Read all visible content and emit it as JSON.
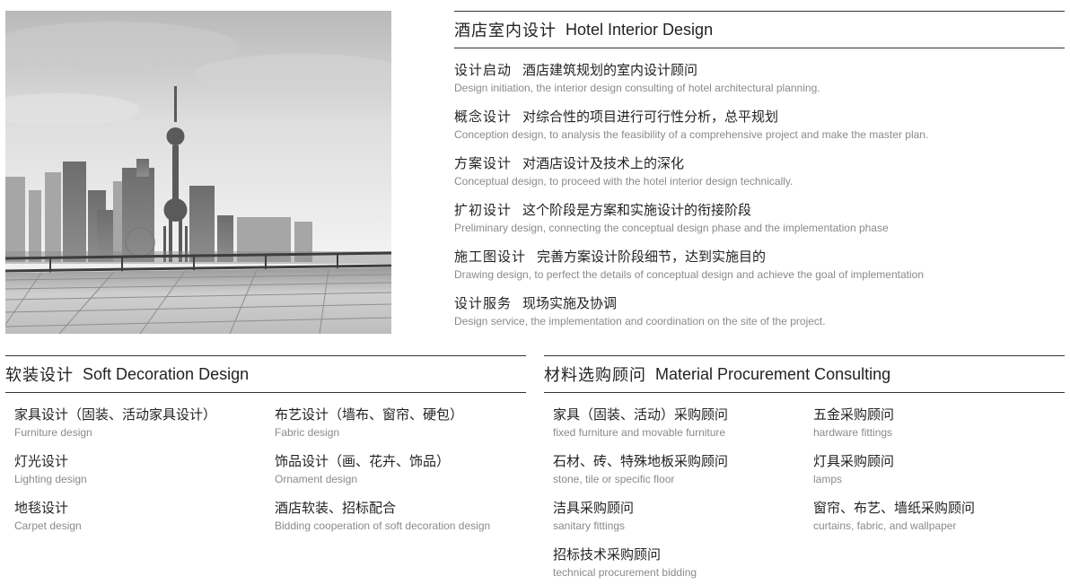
{
  "hotel": {
    "heading_zh": "酒店室内设计",
    "heading_en": "Hotel Interior Design",
    "items": [
      {
        "title": "设计启动",
        "desc": "酒店建筑规划的室内设计顾问",
        "en": "Design initiation, the interior design consulting of hotel architectural planning."
      },
      {
        "title": "概念设计",
        "desc": "对综合性的项目进行可行性分析，总平规划",
        "en": "Conception design, to analysis the feasibility of a comprehensive project and make the master plan."
      },
      {
        "title": "方案设计",
        "desc": "对酒店设计及技术上的深化",
        "en": "Conceptual design, to proceed with the hotel interior design technically."
      },
      {
        "title": "扩初设计",
        "desc": "这个阶段是方案和实施设计的衔接阶段",
        "en": "Preliminary design, connecting the conceptual design phase and the implementation phase"
      },
      {
        "title": "施工图设计",
        "desc": "完善方案设计阶段细节，达到实施目的",
        "en": "Drawing design, to perfect the details of conceptual design and achieve the goal of implementation"
      },
      {
        "title": "设计服务",
        "desc": "现场实施及协调",
        "en": "Design service, the implementation and coordination on the site of the project."
      }
    ]
  },
  "soft": {
    "heading_zh": "软装设计",
    "heading_en": "Soft Decoration Design",
    "items": [
      {
        "zh": "家具设计（固装、活动家具设计）",
        "en": "Furniture design"
      },
      {
        "zh": "布艺设计（墙布、窗帘、硬包）",
        "en": "Fabric design"
      },
      {
        "zh": "灯光设计",
        "en": "Lighting design"
      },
      {
        "zh": "饰品设计（画、花卉、饰品）",
        "en": "Ornament design"
      },
      {
        "zh": "地毯设计",
        "en": "Carpet design"
      },
      {
        "zh": "酒店软装、招标配合",
        "en": "Bidding cooperation of soft decoration design"
      }
    ]
  },
  "material": {
    "heading_zh": "材料选购顾问",
    "heading_en": "Material Procurement Consulting",
    "items": [
      {
        "zh": "家具（固装、活动）采购顾问",
        "en": "fixed furniture and movable furniture"
      },
      {
        "zh": "五金采购顾问",
        "en": "hardware fittings"
      },
      {
        "zh": "石材、砖、特殊地板采购顾问",
        "en": "stone, tile or specific floor"
      },
      {
        "zh": "灯具采购顾问",
        "en": "lamps"
      },
      {
        "zh": "洁具采购顾问",
        "en": "sanitary fittings"
      },
      {
        "zh": "窗帘、布艺、墙纸采购顾问",
        "en": "curtains, fabric, and wallpaper"
      },
      {
        "zh": "招标技术采购顾问",
        "en": "technical procurement bidding"
      }
    ]
  },
  "image": {
    "subject": "city-skyline-photo"
  },
  "colors": {
    "heading": "#222222",
    "subtext": "#8a8a8a",
    "rule": "#333333"
  }
}
